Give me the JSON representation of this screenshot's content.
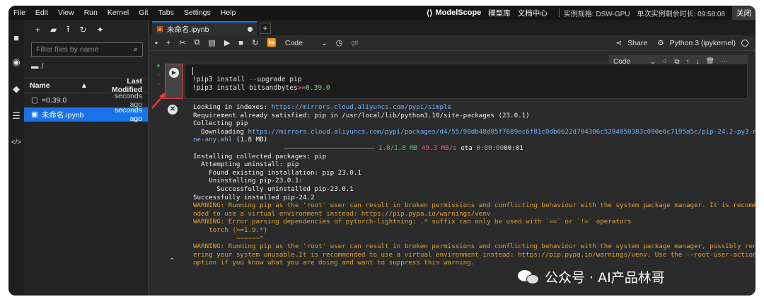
{
  "menubar": {
    "items": [
      "File",
      "Edit",
      "View",
      "Run",
      "Kernel",
      "Git",
      "Tabs",
      "Settings",
      "Help"
    ],
    "brand": "ModelScope",
    "links": [
      "模型库",
      "文档中心"
    ],
    "instance_spec": "实例规格: DSW-GPU",
    "remaining_time": "单次实例剩余时长: 09:58:08",
    "close_label": "关闭"
  },
  "filebrowser": {
    "filter_placeholder": "Filter files by name",
    "breadcrumb": "/",
    "col_name": "Name",
    "col_modified": "Last Modified",
    "files": [
      {
        "name": "=0.39.0",
        "modified": "seconds ago",
        "icon": "file-icon"
      },
      {
        "name": "未命名.ipynb",
        "modified": "seconds ago",
        "icon": "notebook-icon"
      }
    ]
  },
  "notebook": {
    "tab_title": "未命名.ipynb",
    "celltype": "Code",
    "git_label": "git",
    "share_label": "Share",
    "kernel_label": "Python 3 (ipykernel)",
    "cell_toolbar_type": "Code",
    "code": {
      "line1_cmd": "!pip3 install ",
      "line1_op": "--",
      "line1_rest": "upgrade pip",
      "line2_cmd": "!pip3 install bitsandbytes",
      "line2_op": ">=",
      "line2_num": "0.39.0"
    },
    "output": {
      "l1_prefix": "Looking in indexes: ",
      "l1_link": "https://mirrors.cloud.aliyuncs.com/pypi/simple",
      "l2": "Requirement already satisfied: pip in /usr/local/lib/python3.10/site-packages (23.0.1)",
      "l3": "Collecting pip",
      "l4_prefix": "  Downloading ",
      "l4_link": "https://mirrors.cloud.aliyuncs.com/pypi/packages/d4/55/90db48d85f7689ec6f81c0db0622d704306c5284850383c090e6c7195a5c/pip-24.2-py3-no",
      "l5_link": "ne-any.whl",
      "l5_rest": " (1.8 MB)",
      "progress_size": "1.8/1.8 MB",
      "progress_speed": "49.3 MB/s",
      "progress_eta_label": "eta",
      "progress_eta": "0:00:00",
      "progress_tail": "00:01",
      "l7": "Installing collected packages: pip",
      "l8": "  Attempting uninstall: pip",
      "l9": "    Found existing installation: pip 23.0.1",
      "l10": "    Uninstalling pip-23.0.1:",
      "l11": "      Successfully uninstalled pip-23.0.1",
      "l12": "Successfully installed pip-24.2",
      "w1": "WARNING: Running pip as the 'root' user can result in broken permissions and conflicting behaviour with the system package manager. It is recomme",
      "w2": "nded to use a virtual environment instead: https://pip.pypa.io/warnings/venv",
      "w3": "WARNING: Error parsing dependencies of pytorch-lightning: .* suffix can only be used with `==` or `!=` operators",
      "w4": "    torch (>=1.9.*)",
      "w5": "           ~~~~~~^",
      "w6": "WARNING: Running pip as the 'root' user can result in broken permissions and conflicting behaviour with the system package manager, possibly rend",
      "w7": "ering your system unusable.It is recommended to use a virtual environment instead: https://pip.pypa.io/warnings/venv. Use the --root-user-action",
      "w8": "option if you know what you are doing and want to suppress this warning."
    }
  },
  "watermark": {
    "text": "公众号 · AI产品林哥"
  },
  "colors": {
    "selection": "#1a73e8",
    "warning": "#e0a030",
    "link": "#6cb6ff",
    "highlight_border": "#e53935"
  }
}
